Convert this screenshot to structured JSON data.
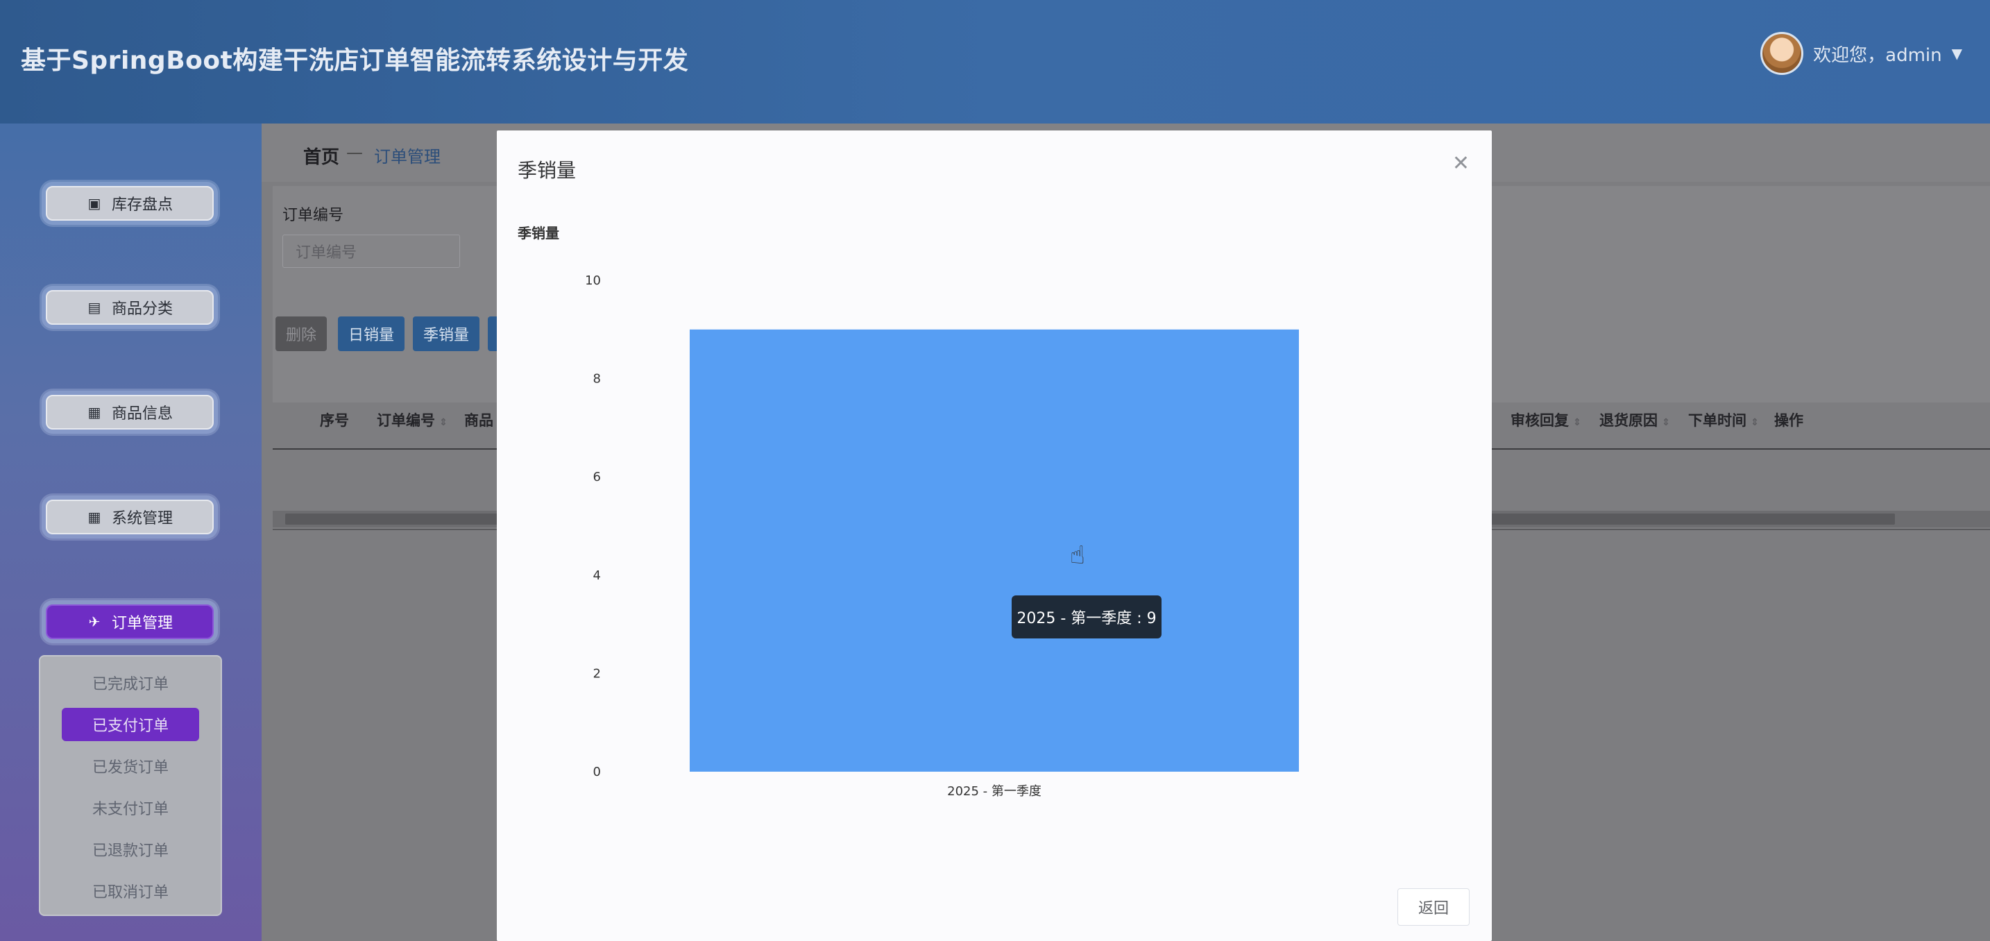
{
  "app": {
    "title": "基于SpringBoot构建干洗店订单智能流转系统设计与开发",
    "welcome": "欢迎您，admin"
  },
  "sidebar": {
    "items": [
      {
        "label": "库存盘点",
        "icon": "clipboard-check-icon"
      },
      {
        "label": "商品分类",
        "icon": "chart-line-icon"
      },
      {
        "label": "商品信息",
        "icon": "grid-icon"
      },
      {
        "label": "系统管理",
        "icon": "grid-icon"
      },
      {
        "label": "订单管理",
        "icon": "ticket-icon",
        "active": true
      }
    ],
    "submenu": [
      {
        "label": "已完成订单"
      },
      {
        "label": "已支付订单",
        "active": true
      },
      {
        "label": "已发货订单"
      },
      {
        "label": "未支付订单"
      },
      {
        "label": "已退款订单"
      },
      {
        "label": "已取消订单"
      }
    ]
  },
  "breadcrumb": {
    "home": "首页",
    "separator": "—",
    "current": "订单管理"
  },
  "search": {
    "label": "订单编号",
    "placeholder": "订单编号"
  },
  "toolbar": {
    "delete": "删除",
    "daily_sales": "日销量",
    "season_sales": "季销量"
  },
  "table": {
    "headers_left": [
      "序号",
      "订单编号",
      "商品"
    ],
    "headers_right": [
      "审核回复",
      "退货原因",
      "下单时间",
      "操作"
    ]
  },
  "modal": {
    "title": "季销量",
    "chart_title": "季销量",
    "tooltip": "2025 - 第一季度 : 9",
    "back_label": "返回",
    "close_icon": "close-icon"
  },
  "colors": {
    "bar": "#579ef3",
    "accent": "#6e2dc4",
    "primary": "#2c5b8f"
  },
  "chart_data": {
    "type": "bar",
    "title": "季销量",
    "categories": [
      "2025 - 第一季度"
    ],
    "values": [
      9
    ],
    "xlabel": "",
    "ylabel": "",
    "ylim": [
      0,
      10
    ],
    "yticks": [
      0,
      2,
      4,
      6,
      8,
      10
    ],
    "grid": false,
    "legend": "none"
  }
}
